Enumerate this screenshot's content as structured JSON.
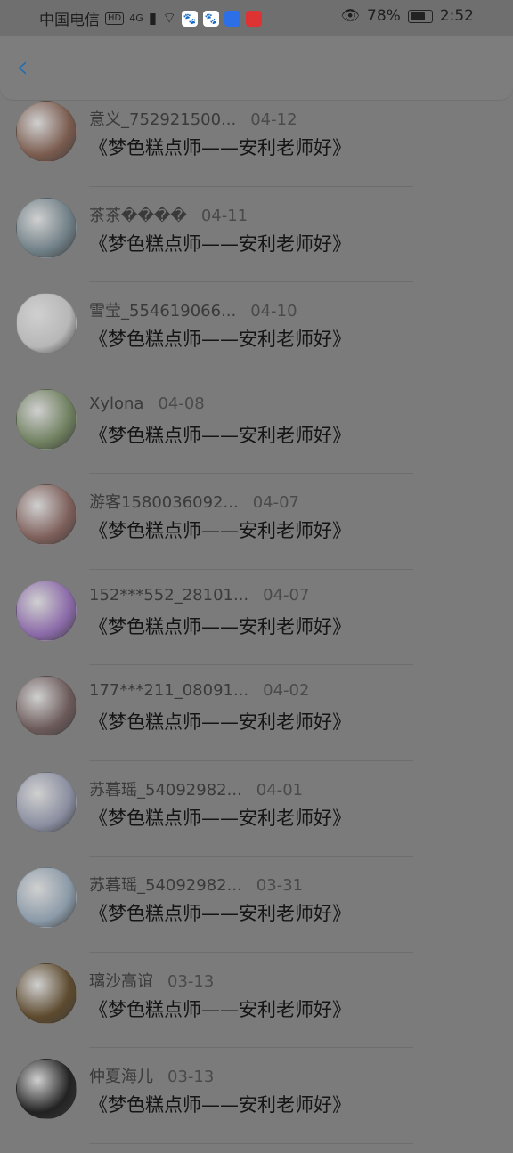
{
  "status_bar": {
    "carrier": "中国电信",
    "hd_badge": "HD",
    "network": "4G",
    "battery_pct": "78%",
    "time": "2:52"
  },
  "header": {
    "back_icon": "chevron-left-icon"
  },
  "items": [
    {
      "name": "意义_752921500...",
      "date": "04-12",
      "message": "《梦色糕点师——安利老师好》",
      "avatar_color": "#7a5b4e"
    },
    {
      "name": "茶茶����",
      "date": "04-11",
      "message": "《梦色糕点师——安利老师好》",
      "avatar_color": "#6f7f86"
    },
    {
      "name": "雪莹_554619066...",
      "date": "04-10",
      "message": "《梦色糕点师——安利老师好》",
      "avatar_color": "#b7b7b7"
    },
    {
      "name": "Xylona",
      "date": "04-08",
      "message": "《梦色糕点师——安利老师好》",
      "avatar_color": "#6f805f"
    },
    {
      "name": "游客1580036092...",
      "date": "04-07",
      "message": "《梦色糕点师——安利老师好》",
      "avatar_color": "#7e5f5a"
    },
    {
      "name": "152***552_28101...",
      "date": "04-07",
      "message": "《梦色糕点师——安利老师好》",
      "avatar_color": "#8b6aa9"
    },
    {
      "name": "177***211_08091...",
      "date": "04-02",
      "message": "《梦色糕点师——安利老师好》",
      "avatar_color": "#6c5a5a"
    },
    {
      "name": "苏暮瑶_54092982...",
      "date": "04-01",
      "message": "《梦色糕点师——安利老师好》",
      "avatar_color": "#8a8ea0"
    },
    {
      "name": "苏暮瑶_54092982...",
      "date": "03-31",
      "message": "《梦色糕点师——安利老师好》",
      "avatar_color": "#8b9aa8"
    },
    {
      "name": "璃沙高谊",
      "date": "03-13",
      "message": "《梦色糕点师——安利老师好》",
      "avatar_color": "#5d4a2e"
    },
    {
      "name": "仲夏海儿",
      "date": "03-13",
      "message": "《梦色糕点师——安利老师好》",
      "avatar_color": "#222222"
    }
  ]
}
